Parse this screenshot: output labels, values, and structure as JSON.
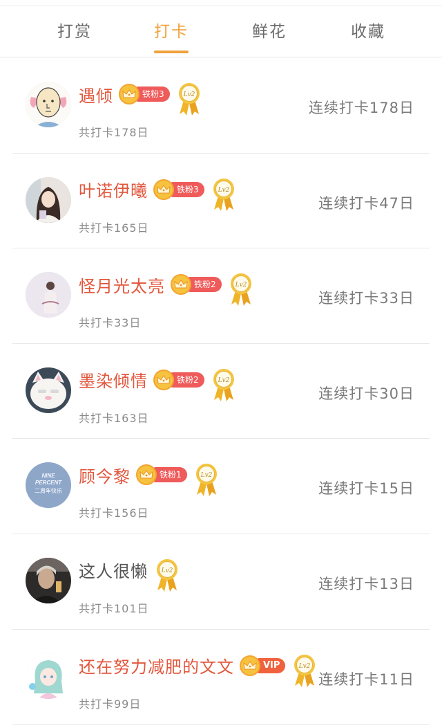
{
  "tabs": [
    {
      "label": "打赏"
    },
    {
      "label": "打卡"
    },
    {
      "label": "鲜花"
    },
    {
      "label": "收藏"
    }
  ],
  "active_tab": 1,
  "colors": {
    "accent": "#f0a23b",
    "name_red": "#e2563c",
    "fan_badge": "#ef5a5a",
    "gold": "#f7c23e"
  },
  "medal_icon": "lv2-gold-medal-icon",
  "users": [
    {
      "name": "遇倾",
      "fan_label": "铁粉3",
      "medal": "Lv2",
      "total": "共打卡178日",
      "streak": "连续打卡178日",
      "avatar": "cartoon-face"
    },
    {
      "name": "叶诺伊曦",
      "fan_label": "铁粉3",
      "medal": "Lv2",
      "total": "共打卡165日",
      "streak": "连续打卡47日",
      "avatar": "photo-girl"
    },
    {
      "name": "怪月光太亮",
      "fan_label": "铁粉2",
      "medal": "Lv2",
      "total": "共打卡33日",
      "streak": "连续打卡33日",
      "avatar": "photo-pale"
    },
    {
      "name": "墨染倾情",
      "fan_label": "铁粉2",
      "medal": "Lv2",
      "total": "共打卡163日",
      "streak": "连续打卡30日",
      "avatar": "cat-face"
    },
    {
      "name": "顾今黎",
      "fan_label": "铁粉1",
      "medal": "Lv2",
      "total": "共打卡156日",
      "streak": "连续打卡15日",
      "avatar": "text-logo",
      "avatar_text": [
        "NINE",
        "PERCENT",
        "二周年快乐"
      ]
    },
    {
      "name": "这人很懒",
      "fan_label": "",
      "medal": "Lv2",
      "total": "共打卡101日",
      "streak": "连续打卡13日",
      "avatar": "photo-dark"
    },
    {
      "name": "还在努力减肥的文文",
      "fan_label": "VIP",
      "medal": "Lv2",
      "total": "共打卡99日",
      "streak": "连续打卡11日",
      "avatar": "anime-girl"
    }
  ]
}
